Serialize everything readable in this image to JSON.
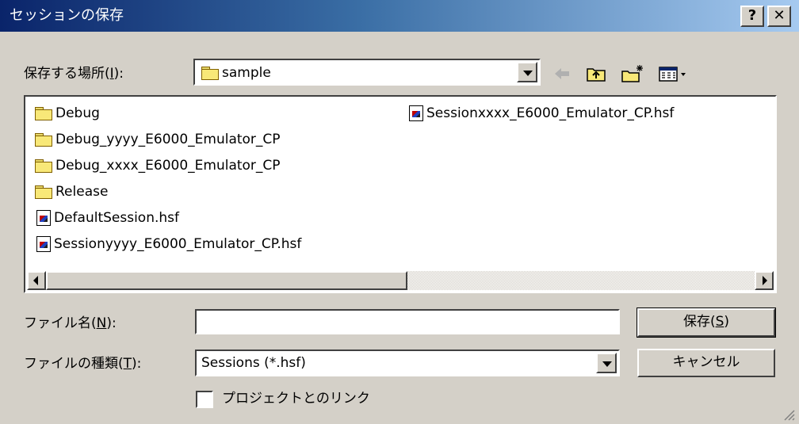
{
  "window": {
    "title": "セッションの保存",
    "help_button": "?",
    "close_button": "✕"
  },
  "location": {
    "label": "保存する場所(I):",
    "label_text": "保存する場所(",
    "label_accel": "I",
    "label_tail": "):",
    "current_folder": "sample"
  },
  "file_list": {
    "items": [
      {
        "name": "Debug",
        "type": "folder"
      },
      {
        "name": "Debug_yyyy_E6000_Emulator_CP",
        "type": "folder"
      },
      {
        "name": "Debug_xxxx_E6000_Emulator_CP",
        "type": "folder"
      },
      {
        "name": "Release",
        "type": "folder"
      },
      {
        "name": "DefaultSession.hsf",
        "type": "file"
      },
      {
        "name": "Sessionyyyy_E6000_Emulator_CP.hsf",
        "type": "file"
      },
      {
        "name": "Sessionxxxx_E6000_Emulator_CP.hsf",
        "type": "file"
      }
    ]
  },
  "filename": {
    "label_text": "ファイル名(",
    "label_accel": "N",
    "label_tail": "):",
    "value": ""
  },
  "filetype": {
    "label_text": "ファイルの種類(",
    "label_accel": "T",
    "label_tail": "):",
    "value": "Sessions (*.hsf)"
  },
  "buttons": {
    "save_text": "保存(",
    "save_accel": "S",
    "save_tail": ")",
    "cancel": "キャンセル"
  },
  "checkbox": {
    "label": "プロジェクトとのリンク",
    "checked": false
  },
  "colors": {
    "title_start": "#0a246a",
    "title_end": "#a6caf0",
    "face": "#d4d0c8"
  }
}
